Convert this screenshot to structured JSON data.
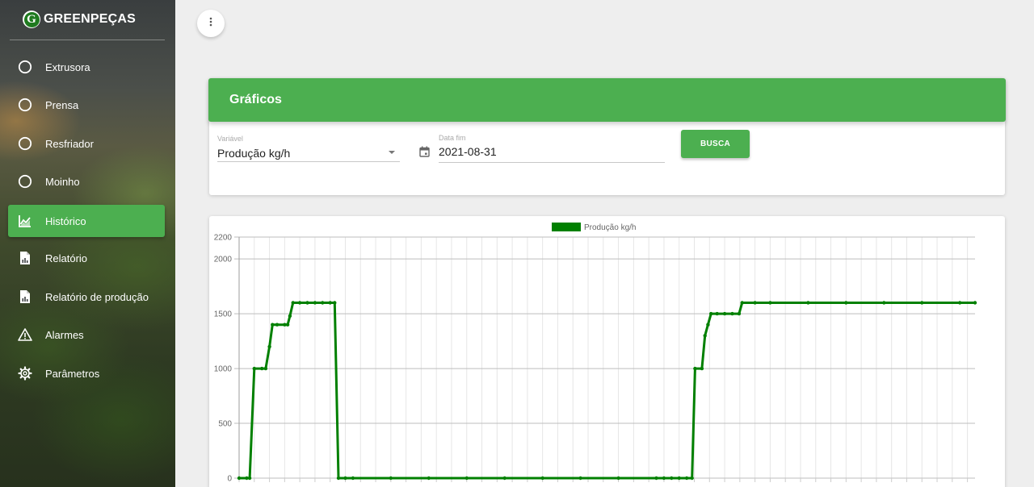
{
  "brand": {
    "logo_letter": "G",
    "name": "GREENPEÇAS"
  },
  "sidebar": {
    "items": [
      {
        "label": "Extrusora",
        "icon": "circle-outline-icon",
        "active": false
      },
      {
        "label": "Prensa",
        "icon": "circle-outline-icon",
        "active": false
      },
      {
        "label": "Resfriador",
        "icon": "circle-outline-icon",
        "active": false
      },
      {
        "label": "Moinho",
        "icon": "circle-outline-icon",
        "active": false
      },
      {
        "label": "Histórico",
        "icon": "area-chart-icon",
        "active": true
      },
      {
        "label": "Relatório",
        "icon": "report-file-icon",
        "active": false
      },
      {
        "label": "Relatório de produção",
        "icon": "report-file-icon",
        "active": false
      },
      {
        "label": "Alarmes",
        "icon": "warning-triangle-icon",
        "active": false
      },
      {
        "label": "Parâmetros",
        "icon": "gear-icon",
        "active": false
      }
    ]
  },
  "top": {
    "menu_icon": "more-vertical-icon"
  },
  "card": {
    "title": "Gráficos",
    "variable": {
      "label": "Variável",
      "value": "Produção kg/h"
    },
    "date": {
      "label": "Data fim",
      "value": "2021-08-31"
    },
    "search_label": "BUSCA"
  },
  "colors": {
    "accent": "#4caf50",
    "series": "#008000"
  },
  "chart_data": {
    "type": "line",
    "legend": [
      "Produção kg/h"
    ],
    "y_ticks": [
      0,
      500,
      1000,
      1500,
      2000,
      2200
    ],
    "ylim": [
      0,
      2200
    ],
    "grid": true,
    "series": [
      {
        "name": "Produção kg/h",
        "points": [
          [
            0,
            0
          ],
          [
            1,
            0
          ],
          [
            1.4,
            0
          ],
          [
            2,
            1000
          ],
          [
            3,
            1000
          ],
          [
            3.5,
            1000
          ],
          [
            4,
            1200
          ],
          [
            4.4,
            1400
          ],
          [
            5,
            1400
          ],
          [
            6,
            1400
          ],
          [
            6.4,
            1400
          ],
          [
            6.7,
            1480
          ],
          [
            7.1,
            1600
          ],
          [
            8,
            1600
          ],
          [
            9,
            1600
          ],
          [
            10,
            1600
          ],
          [
            11,
            1600
          ],
          [
            12,
            1600
          ],
          [
            12.6,
            1600
          ],
          [
            13.1,
            0
          ],
          [
            14,
            0
          ],
          [
            15,
            0
          ],
          [
            20,
            0
          ],
          [
            25,
            0
          ],
          [
            30,
            0
          ],
          [
            35,
            0
          ],
          [
            40,
            0
          ],
          [
            45,
            0
          ],
          [
            50,
            0
          ],
          [
            55,
            0
          ],
          [
            56,
            0
          ],
          [
            57,
            0
          ],
          [
            58,
            0
          ],
          [
            59,
            0
          ],
          [
            59.7,
            0
          ],
          [
            60.1,
            1000
          ],
          [
            61,
            1000
          ],
          [
            61.4,
            1300
          ],
          [
            61.8,
            1400
          ],
          [
            62.2,
            1500
          ],
          [
            63,
            1500
          ],
          [
            64,
            1500
          ],
          [
            65,
            1500
          ],
          [
            65.9,
            1500
          ],
          [
            66.3,
            1600
          ],
          [
            68,
            1600
          ],
          [
            70,
            1600
          ],
          [
            75,
            1600
          ],
          [
            80,
            1600
          ],
          [
            85,
            1600
          ],
          [
            90,
            1600
          ],
          [
            95,
            1600
          ],
          [
            97,
            1600
          ]
        ]
      }
    ]
  }
}
